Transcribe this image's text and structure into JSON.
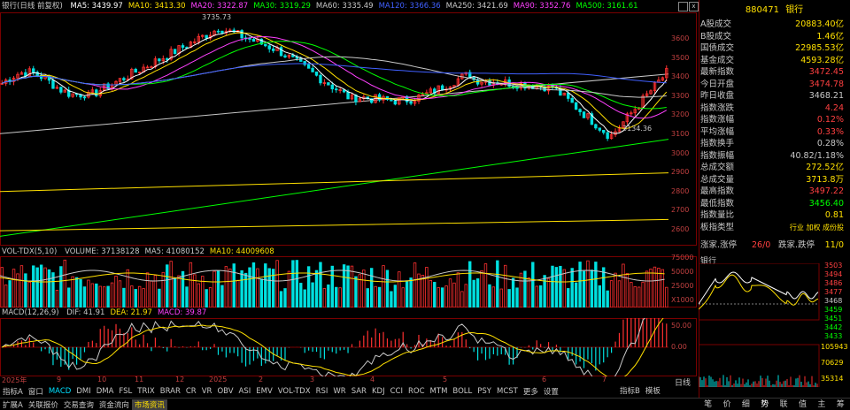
{
  "main_chart": {
    "title": "银行(日线 前复权)",
    "ma": [
      {
        "label": "MA5: 3439.97",
        "color": "#ffffff"
      },
      {
        "label": "MA10: 3413.30",
        "color": "#ffe000"
      },
      {
        "label": "MA20: 3322.87",
        "color": "#ff40ff"
      },
      {
        "label": "MA30: 3319.29",
        "color": "#00ff00"
      },
      {
        "label": "MA60: 3335.49",
        "color": "#c8c8c8"
      },
      {
        "label": "MA120: 3366.36",
        "color": "#4060ff"
      },
      {
        "label": "MA250: 3421.69",
        "color": "#c8c8c8"
      },
      {
        "label": "MA90: 3352.76",
        "color": "#ff40ff"
      },
      {
        "label": "MA500: 3161.61",
        "color": "#00ff00"
      }
    ],
    "high_label": "3735.73",
    "low_label": "3134.36",
    "y_labels": [
      "3600",
      "3500",
      "3400",
      "3300",
      "3200",
      "3100",
      "3000",
      "2900",
      "2800",
      "2700",
      "2600"
    ],
    "x_labels": [
      "2025年",
      "9",
      "10",
      "11",
      "12",
      "2025",
      "2",
      "3",
      "4",
      "5",
      "6",
      "7"
    ]
  },
  "volume_chart": {
    "title": "VOL-TDX(5,10)",
    "items": [
      {
        "label": "VOLUME: 37138128",
        "color": "#c8c8c8"
      },
      {
        "label": "MA5: 41080152",
        "color": "#c8c8c8"
      },
      {
        "label": "MA10: 44009608",
        "color": "#ffe000"
      }
    ],
    "y_labels": [
      "75000",
      "50000",
      "25000",
      "X1000"
    ]
  },
  "macd_chart": {
    "title": "MACD(12,26,9)",
    "items": [
      {
        "label": "DIF: 41.91",
        "color": "#c8c8c8"
      },
      {
        "label": "DEA: 21.97",
        "color": "#ffe000"
      },
      {
        "label": "MACD: 39.87",
        "color": "#ff40ff"
      }
    ],
    "y_labels": [
      "50.00",
      "0.00"
    ]
  },
  "indicator_tabs": [
    "指标A",
    "窗口",
    "MACD",
    "DMI",
    "DMA",
    "FSL",
    "TRIX",
    "BRAR",
    "CR",
    "VR",
    "OBV",
    "ASI",
    "EMV",
    "VOL-TDX",
    "RSI",
    "WR",
    "SAR",
    "KDJ",
    "CCI",
    "ROC",
    "MTM",
    "BOLL",
    "PSY",
    "MCST",
    "更多",
    "设置"
  ],
  "indicator_tabs_right": [
    "指标B",
    "模板"
  ],
  "bottom_bar": [
    "扩展A",
    "关联报价",
    "交易查询",
    "资金流向",
    "市场资讯"
  ],
  "side_panel": {
    "code": "880471",
    "name": "银行",
    "rows": [
      {
        "k": "A股成交",
        "v": "20883.40亿",
        "c": "#ffe000"
      },
      {
        "k": "B股成交",
        "v": "1.46亿",
        "c": "#ffe000"
      },
      {
        "k": "国债成交",
        "v": "22985.53亿",
        "c": "#ffe000"
      },
      {
        "k": "基金成交",
        "v": "4593.28亿",
        "c": "#ffe000"
      },
      {
        "k": "最新指数",
        "v": "3472.45",
        "c": "#ff4040"
      },
      {
        "k": "今日开盘",
        "v": "3474.78",
        "c": "#ff4040"
      },
      {
        "k": "昨日收盘",
        "v": "3468.21",
        "c": "#c8c8c8"
      },
      {
        "k": "指数涨跌",
        "v": "4.24",
        "c": "#ff4040"
      },
      {
        "k": "指数涨幅",
        "v": "0.12%",
        "c": "#ff4040"
      },
      {
        "k": "平均涨幅",
        "v": "0.33%",
        "c": "#ff4040"
      },
      {
        "k": "指数换手",
        "v": "0.28%",
        "c": "#c8c8c8"
      },
      {
        "k": "指数振幅",
        "v": "40.82/1.18%",
        "c": "#c8c8c8"
      },
      {
        "k": "总成交额",
        "v": "272.52亿",
        "c": "#ffe000"
      },
      {
        "k": "总成交量",
        "v": "3713.8万",
        "c": "#ffe000"
      },
      {
        "k": "最高指数",
        "v": "3497.22",
        "c": "#ff4040"
      },
      {
        "k": "最低指数",
        "v": "3456.40",
        "c": "#00ff00"
      },
      {
        "k": "指数量比",
        "v": "0.81",
        "c": "#ffe000"
      },
      {
        "k": "板指类型",
        "v": "行业 加权 成份股",
        "c": "#ffe000"
      }
    ],
    "rise_fall": {
      "k1": "涨家.涨停",
      "v1": "26/0",
      "k2": "跌家.跌停",
      "v2": "11/0"
    },
    "mini_title": "银行",
    "mini_y_right": [
      "3503",
      "3494",
      "3486",
      "3477",
      "3468",
      "3459",
      "3451",
      "3442",
      "3433"
    ],
    "mini_vol_right": [
      "105943",
      "70629",
      "35314"
    ],
    "mini_bottom_label": "日线",
    "tabs": [
      "笔",
      "价",
      "细",
      "势",
      "联",
      "值",
      "主",
      "筹"
    ]
  }
}
